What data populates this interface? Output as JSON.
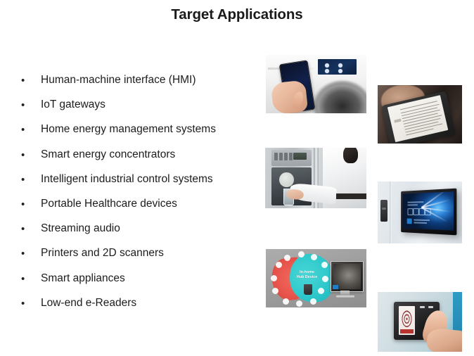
{
  "slide": {
    "title": "Target Applications",
    "background_color": "#ffffff",
    "text_color": "#1c1c1c",
    "bullet_marker": "•"
  },
  "bullets": [
    {
      "label": "Human-machine interface (HMI)"
    },
    {
      "label": "IoT gateways"
    },
    {
      "label": "Home energy management systems"
    },
    {
      "label": "Smart energy concentrators"
    },
    {
      "label": "Intelligent industrial control systems"
    },
    {
      "label": "Portable Healthcare devices"
    },
    {
      "label": "Streaming audio"
    },
    {
      "label": "Printers and 2D scanners"
    },
    {
      "label": "Smart appliances"
    },
    {
      "label": "Low-end e-Readers"
    }
  ],
  "photos": [
    {
      "name": "smartphone-controlling-washing-machine",
      "caption": ""
    },
    {
      "name": "handheld-e-reader",
      "caption": ""
    },
    {
      "name": "refrigerator-water-dispenser",
      "caption": ""
    },
    {
      "name": "wall-mounted-smart-display",
      "caption": ""
    },
    {
      "name": "in-home-hub-device",
      "caption": "In-home\nHub Device",
      "caption_line1": "In-home",
      "caption_line2": "Hub Device",
      "accent_red": "#e8554c",
      "accent_cyan": "#2fc9cc"
    },
    {
      "name": "fingerprint-scanner",
      "caption": ""
    }
  ]
}
